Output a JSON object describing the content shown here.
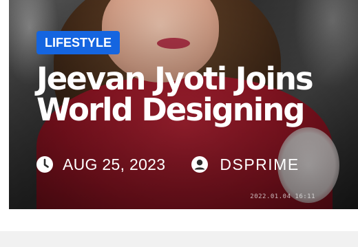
{
  "post": {
    "category": "LIFESTYLE",
    "title": "Jeevan Jyoti Joins World Designing",
    "date": "AUG 25, 2023",
    "author": "DSPRIME",
    "photo_timestamp": "2022.01.04 16:11"
  },
  "icons": {
    "date": "clock-icon",
    "author": "user-circle-icon"
  },
  "colors": {
    "badge_bg": "#1565e0",
    "text": "#ffffff",
    "footer_bg": "#f1f1f1"
  }
}
